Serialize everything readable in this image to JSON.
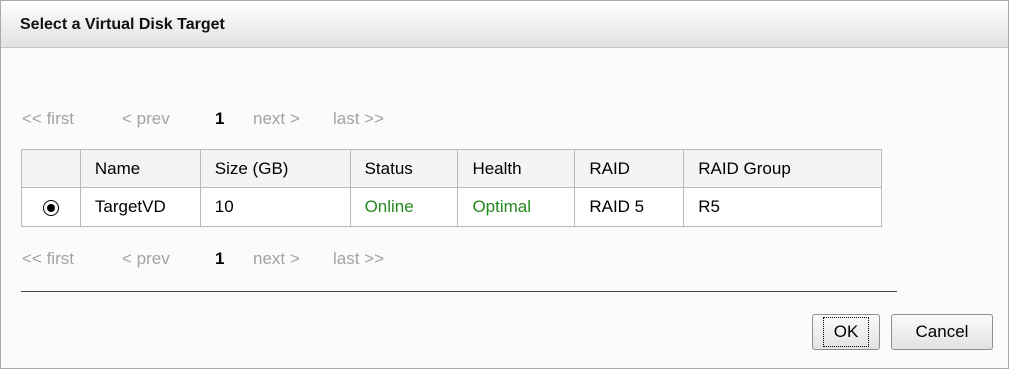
{
  "dialog": {
    "title": "Select a Virtual Disk Target"
  },
  "pager": {
    "first": "<< first",
    "prev": "< prev",
    "current": "1",
    "next": "next >",
    "last": "last >>"
  },
  "table": {
    "columns": [
      "Name",
      "Size (GB)",
      "Status",
      "Health",
      "RAID",
      "RAID Group"
    ],
    "rows": [
      {
        "selected": true,
        "name": "TargetVD",
        "size": "10",
        "status": "Online",
        "health": "Optimal",
        "raid": "RAID 5",
        "raid_group": "R5"
      }
    ]
  },
  "buttons": {
    "ok": "OK",
    "cancel": "Cancel"
  },
  "colors": {
    "status_ok": "#23891d",
    "pager_disabled": "#a3a3a3"
  }
}
